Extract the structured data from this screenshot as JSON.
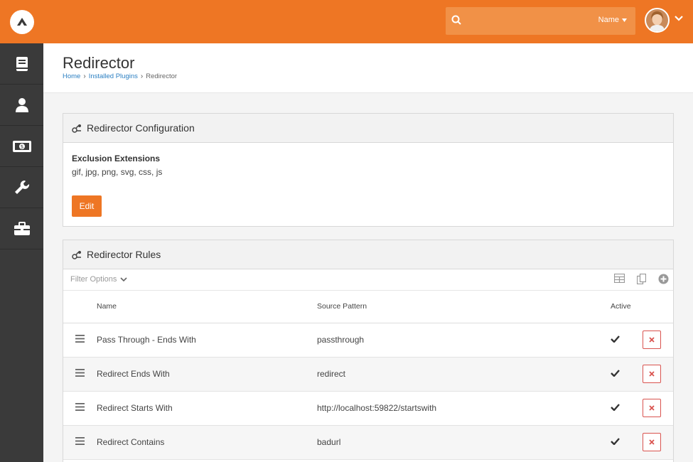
{
  "header": {
    "search": {
      "placeholder": "",
      "type_label": "Name"
    }
  },
  "sidebar": {
    "items": [
      {
        "name": "book"
      },
      {
        "name": "person"
      },
      {
        "name": "money"
      },
      {
        "name": "wrench"
      },
      {
        "name": "briefcase"
      }
    ]
  },
  "page": {
    "title": "Redirector",
    "breadcrumb": [
      "Home",
      "Installed Plugins",
      "Redirector"
    ]
  },
  "config_panel": {
    "title": "Redirector Configuration",
    "field_label": "Exclusion Extensions",
    "field_value": "gif, jpg, png, svg, css, js",
    "edit_label": "Edit"
  },
  "rules_panel": {
    "title": "Redirector Rules",
    "filter_label": "Filter Options",
    "columns": {
      "name": "Name",
      "source": "Source Pattern",
      "active": "Active"
    },
    "rows": [
      {
        "name": "Pass Through - Ends With",
        "source": "passthrough",
        "active": true
      },
      {
        "name": "Redirect Ends With",
        "source": "redirect",
        "active": true
      },
      {
        "name": "Redirect Starts With",
        "source": "http://localhost:59822/startswith",
        "active": true
      },
      {
        "name": "Redirect Contains",
        "source": "badurl",
        "active": true
      }
    ]
  },
  "colors": {
    "accent": "#ee7624",
    "sidebar": "#3a3a3a",
    "link": "#2b7fc2",
    "danger": "#d9534f"
  }
}
